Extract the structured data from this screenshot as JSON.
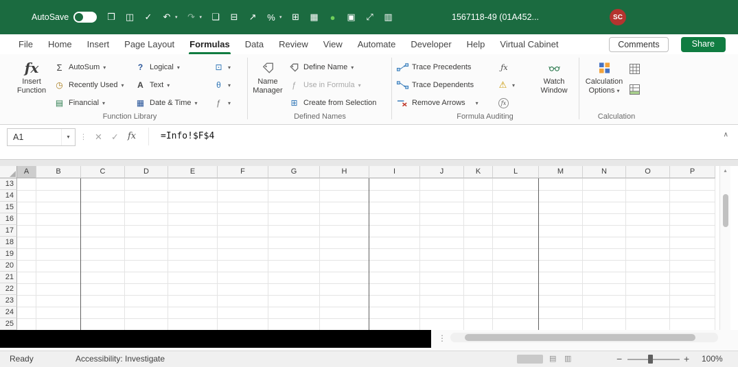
{
  "titlebar": {
    "autosave_label": "AutoSave",
    "document_title": "1567118-49 (01A452...",
    "avatar_initials": "SC"
  },
  "qat_icons": [
    {
      "name": "open-icon",
      "glyph": "❒"
    },
    {
      "name": "save-icon",
      "glyph": "◫"
    },
    {
      "name": "clipboard-check-icon",
      "glyph": "✓"
    },
    {
      "name": "undo-icon",
      "glyph": "↶",
      "caret": true
    },
    {
      "name": "redo-icon",
      "glyph": "↷",
      "caret": true,
      "dim": true
    },
    {
      "name": "new-document-icon",
      "glyph": "❑"
    },
    {
      "name": "table-attach-icon",
      "glyph": "⊟"
    },
    {
      "name": "export-icon",
      "glyph": "↗"
    },
    {
      "name": "percent-style-icon",
      "glyph": "%",
      "caret": true
    },
    {
      "name": "insert-table-icon",
      "glyph": "⊞"
    },
    {
      "name": "table-icon",
      "glyph": "▦"
    },
    {
      "name": "record-macro-icon",
      "glyph": "●",
      "color": "#6fcf5a"
    },
    {
      "name": "grid-icon",
      "glyph": "▣"
    },
    {
      "name": "resize-icon",
      "glyph": "⤢"
    },
    {
      "name": "columns-icon",
      "glyph": "▥"
    }
  ],
  "tabs": {
    "items": [
      "File",
      "Home",
      "Insert",
      "Page Layout",
      "Formulas",
      "Data",
      "Review",
      "View",
      "Automate",
      "Developer",
      "Help",
      "Virtual Cabinet"
    ],
    "active": "Formulas",
    "comments_label": "Comments",
    "share_label": "Share"
  },
  "ribbon": {
    "insert_function": "Insert Function",
    "function_library": {
      "label": "Function Library",
      "autosum": "AutoSum",
      "recently_used": "Recently Used",
      "financial": "Financial",
      "logical": "Logical",
      "text": "Text",
      "date_time": "Date & Time"
    },
    "defined_names": {
      "label": "Defined Names",
      "name_manager": "Name Manager",
      "define_name": "Define Name",
      "use_in_formula": "Use in Formula",
      "create_from_selection": "Create from Selection"
    },
    "formula_auditing": {
      "label": "Formula Auditing",
      "trace_precedents": "Trace Precedents",
      "trace_dependents": "Trace Dependents",
      "remove_arrows": "Remove Arrows",
      "watch_window": "Watch Window"
    },
    "calculation": {
      "label": "Calculation",
      "options": "Calculation Options"
    }
  },
  "formula_bar": {
    "name_box": "A1",
    "formula": "=Info!$F$4"
  },
  "grid": {
    "columns": [
      "A",
      "B",
      "C",
      "D",
      "E",
      "F",
      "G",
      "H",
      "I",
      "J",
      "K",
      "L",
      "M",
      "N",
      "O",
      "P"
    ],
    "rows": [
      "13",
      "14",
      "15",
      "16",
      "17",
      "18",
      "19",
      "20",
      "21",
      "22",
      "23",
      "24",
      "25"
    ],
    "selected_column": "A"
  },
  "status_bar": {
    "ready": "Ready",
    "accessibility": "Accessibility: Investigate",
    "zoom": "100%"
  },
  "icons": {
    "caret": "▾",
    "autosum": "Σ",
    "recently_used": "◷",
    "financial": "▤",
    "logical": "?",
    "text_fn": "A",
    "date_time": "▦",
    "lookup_reference": "⊡",
    "math_trig": "θ",
    "more_functions": "ƒ",
    "insert_function": "fx",
    "use_in_formula": "ƒ",
    "create_from_selection": "⊞",
    "show_formulas": "ƒx",
    "error_checking": "⚠",
    "evaluate_formula": "fx",
    "cancel": "✕",
    "enter": "✓",
    "fx": "fx",
    "collapse": "∧",
    "drag_dots": "⋮",
    "scroll_up": "▴",
    "page_layout_view": "▤",
    "page_break_view": "▥",
    "zoom_out": "−",
    "zoom_in": "+"
  },
  "colors": {
    "accent_green": "#107C41",
    "titlebar_green": "#1b6b40"
  }
}
